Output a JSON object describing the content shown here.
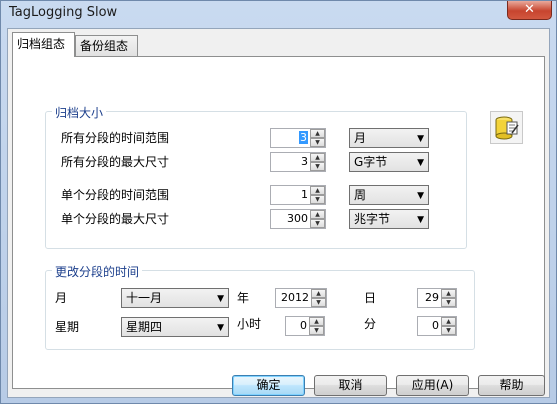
{
  "window": {
    "title": "TagLogging Slow",
    "close_symbol": "✕"
  },
  "tabs": [
    {
      "label": "归档组态"
    },
    {
      "label": "备份组态"
    }
  ],
  "archive_size": {
    "title": "归档大小",
    "rows": [
      {
        "label": "所有分段的时间范围",
        "value": "3",
        "unit": "月"
      },
      {
        "label": "所有分段的最大尺寸",
        "value": "3",
        "unit": "G字节"
      },
      {
        "label": "单个分段的时间范围",
        "value": "1",
        "unit": "周"
      },
      {
        "label": "单个分段的最大尺寸",
        "value": "300",
        "unit": "兆字节"
      }
    ]
  },
  "change_time": {
    "title": "更改分段的时间",
    "month_label": "月",
    "month_value": "十一月",
    "year_label": "年",
    "year_value": "2012",
    "day_label": "日",
    "day_value": "29",
    "weekday_label": "星期",
    "weekday_value": "星期四",
    "hour_label": "小时",
    "hour_value": "0",
    "minute_label": "分",
    "minute_value": "0"
  },
  "buttons": {
    "ok": "确定",
    "cancel": "取消",
    "apply": "应用(A)",
    "help": "帮助"
  },
  "spinner": {
    "up": "▲",
    "down": "▼"
  },
  "combo_arrow": "▼"
}
